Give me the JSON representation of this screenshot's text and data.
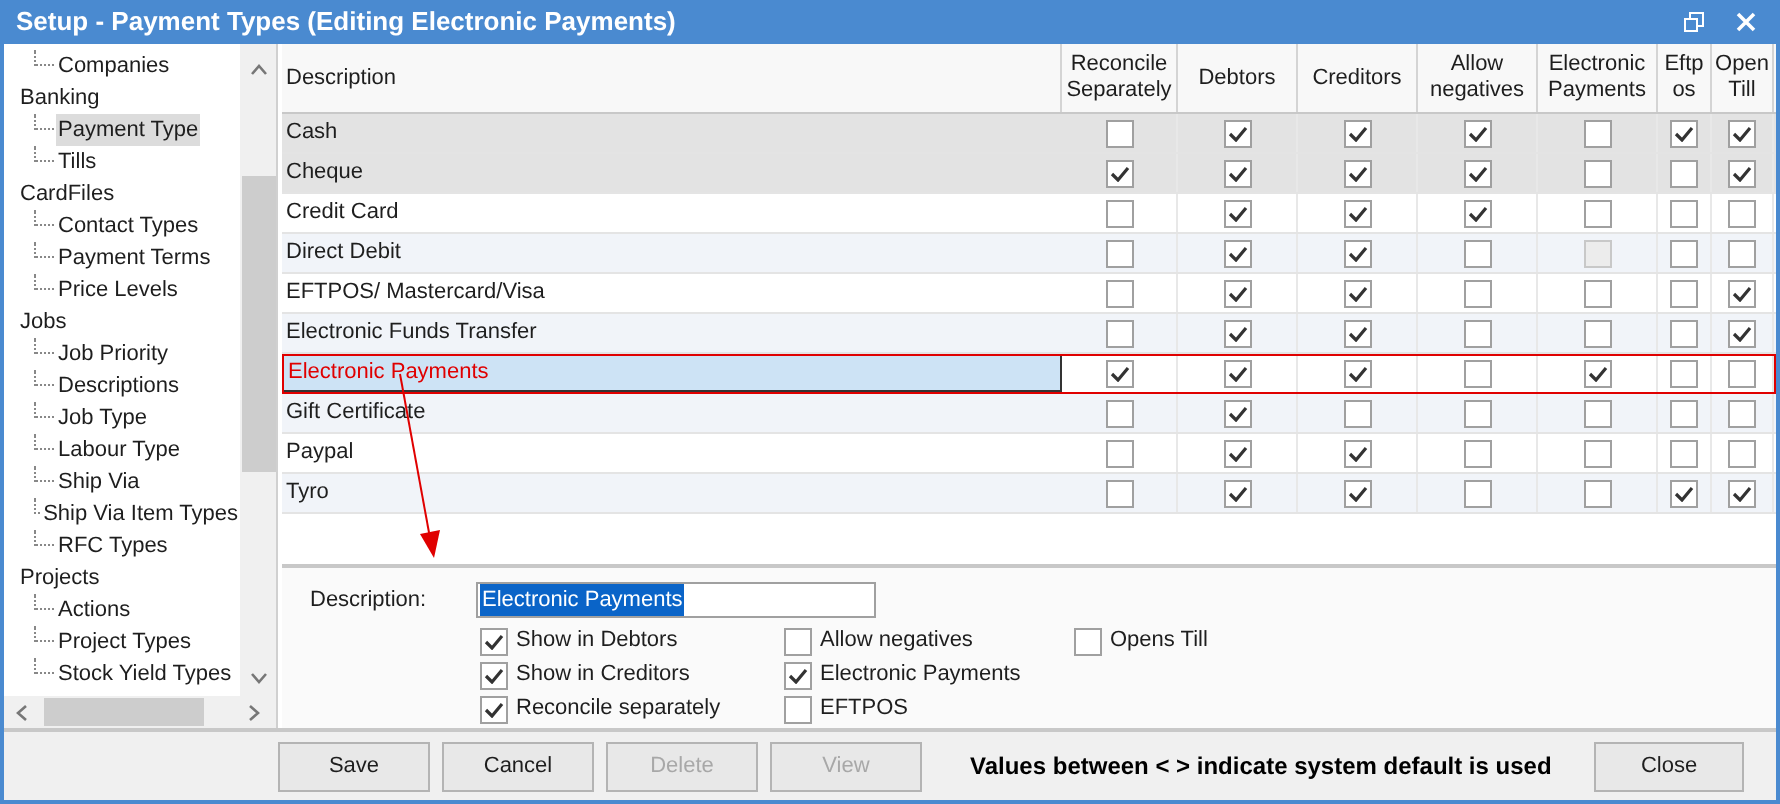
{
  "window": {
    "title": "Setup - Payment Types (Editing Electronic Payments)"
  },
  "sidebar": {
    "items": [
      {
        "label": "Companies",
        "selected": false,
        "kind": "leaf"
      },
      {
        "label": "Banking",
        "selected": false,
        "children": [
          {
            "label": "Payment Type",
            "selected": true
          },
          {
            "label": "Tills",
            "selected": false
          }
        ]
      },
      {
        "label": "CardFiles",
        "selected": false,
        "children": [
          {
            "label": "Contact Types",
            "selected": false
          },
          {
            "label": "Payment Terms",
            "selected": false
          },
          {
            "label": "Price Levels",
            "selected": false
          }
        ]
      },
      {
        "label": "Jobs",
        "selected": false,
        "children": [
          {
            "label": "Job Priority",
            "selected": false
          },
          {
            "label": "Descriptions",
            "selected": false
          },
          {
            "label": "Job Type",
            "selected": false
          },
          {
            "label": "Labour Type",
            "selected": false
          },
          {
            "label": "Ship Via",
            "selected": false
          },
          {
            "label": "Ship Via Item Types",
            "selected": false
          },
          {
            "label": "RFC Types",
            "selected": false
          }
        ]
      },
      {
        "label": "Projects",
        "selected": false,
        "children": [
          {
            "label": "Actions",
            "selected": false
          },
          {
            "label": "Project Types",
            "selected": false
          },
          {
            "label": "Stock Yield Types",
            "selected": false
          }
        ]
      }
    ]
  },
  "table": {
    "columns": [
      "Description",
      "Reconcile Separately",
      "Debtors",
      "Creditors",
      "Allow negatives",
      "Electronic Payments",
      "Eftp os",
      "Open Till"
    ],
    "rows": [
      {
        "description": "Cash",
        "shaded": true,
        "selected": false,
        "cells": [
          {
            "checked": false,
            "disabled": false
          },
          {
            "checked": true,
            "disabled": false
          },
          {
            "checked": true,
            "disabled": false
          },
          {
            "checked": true,
            "disabled": false
          },
          {
            "checked": false,
            "disabled": false
          },
          {
            "checked": true,
            "disabled": false
          },
          {
            "checked": true,
            "disabled": false
          }
        ]
      },
      {
        "description": "Cheque",
        "shaded": true,
        "selected": false,
        "cells": [
          {
            "checked": true,
            "disabled": false
          },
          {
            "checked": true,
            "disabled": false
          },
          {
            "checked": true,
            "disabled": false
          },
          {
            "checked": true,
            "disabled": false
          },
          {
            "checked": false,
            "disabled": false
          },
          {
            "checked": false,
            "disabled": false
          },
          {
            "checked": true,
            "disabled": false
          }
        ]
      },
      {
        "description": "Credit Card",
        "shaded": false,
        "selected": false,
        "cells": [
          {
            "checked": false,
            "disabled": false
          },
          {
            "checked": true,
            "disabled": false
          },
          {
            "checked": true,
            "disabled": false
          },
          {
            "checked": true,
            "disabled": false
          },
          {
            "checked": false,
            "disabled": false
          },
          {
            "checked": false,
            "disabled": false
          },
          {
            "checked": false,
            "disabled": false
          }
        ]
      },
      {
        "description": "Direct Debit",
        "shaded": false,
        "selected": false,
        "cells": [
          {
            "checked": false,
            "disabled": false
          },
          {
            "checked": true,
            "disabled": false
          },
          {
            "checked": true,
            "disabled": false
          },
          {
            "checked": false,
            "disabled": false
          },
          {
            "checked": false,
            "disabled": true
          },
          {
            "checked": false,
            "disabled": false
          },
          {
            "checked": false,
            "disabled": false
          }
        ]
      },
      {
        "description": "EFTPOS/ Mastercard/Visa",
        "shaded": false,
        "selected": false,
        "cells": [
          {
            "checked": false,
            "disabled": false
          },
          {
            "checked": true,
            "disabled": false
          },
          {
            "checked": true,
            "disabled": false
          },
          {
            "checked": false,
            "disabled": false
          },
          {
            "checked": false,
            "disabled": false
          },
          {
            "checked": false,
            "disabled": false
          },
          {
            "checked": true,
            "disabled": false
          }
        ]
      },
      {
        "description": "Electronic Funds Transfer",
        "shaded": false,
        "selected": false,
        "cells": [
          {
            "checked": false,
            "disabled": false
          },
          {
            "checked": true,
            "disabled": false
          },
          {
            "checked": true,
            "disabled": false
          },
          {
            "checked": false,
            "disabled": false
          },
          {
            "checked": false,
            "disabled": false
          },
          {
            "checked": false,
            "disabled": false
          },
          {
            "checked": true,
            "disabled": false
          }
        ]
      },
      {
        "description": "Electronic Payments",
        "shaded": false,
        "selected": true,
        "cells": [
          {
            "checked": true,
            "disabled": false
          },
          {
            "checked": true,
            "disabled": false
          },
          {
            "checked": true,
            "disabled": false
          },
          {
            "checked": false,
            "disabled": false
          },
          {
            "checked": true,
            "disabled": false
          },
          {
            "checked": false,
            "disabled": false
          },
          {
            "checked": false,
            "disabled": false
          }
        ]
      },
      {
        "description": "Gift Certificate",
        "shaded": false,
        "selected": false,
        "cells": [
          {
            "checked": false,
            "disabled": false
          },
          {
            "checked": true,
            "disabled": false
          },
          {
            "checked": false,
            "disabled": false
          },
          {
            "checked": false,
            "disabled": false
          },
          {
            "checked": false,
            "disabled": false
          },
          {
            "checked": false,
            "disabled": false
          },
          {
            "checked": false,
            "disabled": false
          }
        ]
      },
      {
        "description": "Paypal",
        "shaded": false,
        "selected": false,
        "cells": [
          {
            "checked": false,
            "disabled": false
          },
          {
            "checked": true,
            "disabled": false
          },
          {
            "checked": true,
            "disabled": false
          },
          {
            "checked": false,
            "disabled": false
          },
          {
            "checked": false,
            "disabled": false
          },
          {
            "checked": false,
            "disabled": false
          },
          {
            "checked": false,
            "disabled": false
          }
        ]
      },
      {
        "description": "Tyro",
        "shaded": false,
        "selected": false,
        "cells": [
          {
            "checked": false,
            "disabled": false
          },
          {
            "checked": true,
            "disabled": false
          },
          {
            "checked": true,
            "disabled": false
          },
          {
            "checked": false,
            "disabled": false
          },
          {
            "checked": false,
            "disabled": false
          },
          {
            "checked": true,
            "disabled": false
          },
          {
            "checked": true,
            "disabled": false
          }
        ]
      }
    ]
  },
  "form": {
    "description_label": "Description:",
    "description_value": "Electronic Payments",
    "options": [
      [
        {
          "label": "Show in Debtors",
          "checked": true
        },
        {
          "label": "Show in Creditors",
          "checked": true
        },
        {
          "label": "Reconcile separately",
          "checked": true
        }
      ],
      [
        {
          "label": "Allow negatives",
          "checked": false
        },
        {
          "label": "Electronic Payments",
          "checked": true
        },
        {
          "label": "EFTPOS",
          "checked": false
        }
      ],
      [
        {
          "label": "Opens Till",
          "checked": false
        }
      ]
    ]
  },
  "footer": {
    "buttons": [
      {
        "label": "Save",
        "disabled": false
      },
      {
        "label": "Cancel",
        "disabled": false
      },
      {
        "label": "Delete",
        "disabled": true
      },
      {
        "label": "View",
        "disabled": true
      }
    ],
    "note": "Values between < > indicate system default is used",
    "close": "Close"
  }
}
